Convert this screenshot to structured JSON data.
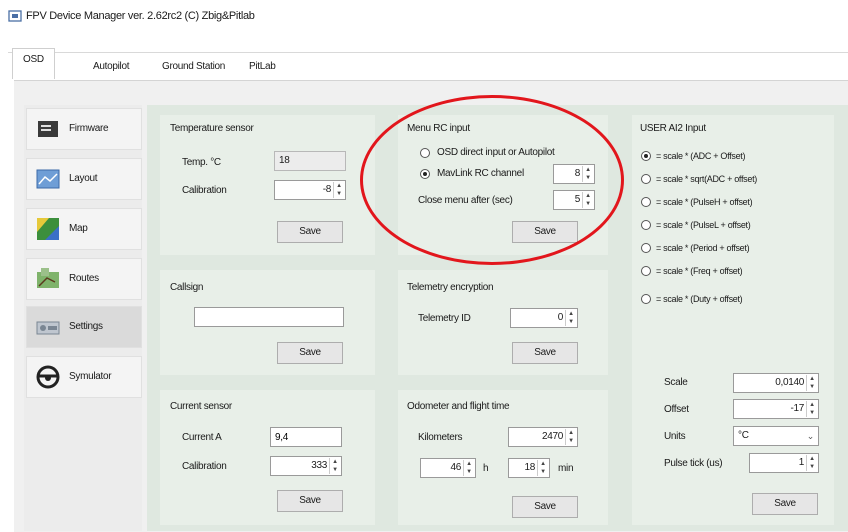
{
  "window": {
    "title": "FPV Device Manager ver. 2.62rc2 (C) Zbig&Pitlab"
  },
  "tabs": [
    {
      "label": "OSD",
      "active": true
    },
    {
      "label": "Autopilot",
      "active": false
    },
    {
      "label": "Ground Station",
      "active": false
    },
    {
      "label": "PitLab",
      "active": false
    }
  ],
  "sidebar": {
    "items": [
      {
        "label": "Firmware",
        "icon": "firmware-chip-icon",
        "active": false
      },
      {
        "label": "Layout",
        "icon": "layout-icon",
        "active": false
      },
      {
        "label": "Map",
        "icon": "map-icon",
        "active": false
      },
      {
        "label": "Routes",
        "icon": "routes-icon",
        "active": false
      },
      {
        "label": "Settings",
        "icon": "settings-icon",
        "active": true
      },
      {
        "label": "Symulator",
        "icon": "steering-wheel-icon",
        "active": false
      }
    ]
  },
  "temperature_sensor": {
    "title": "Temperature sensor",
    "temp_label": "Temp. °C",
    "temp_value": "18",
    "calibration_label": "Calibration",
    "calibration_value": "-8",
    "save_label": "Save"
  },
  "menu_rc_input": {
    "title": "Menu RC input",
    "option1": "OSD direct input or Autopilot",
    "option2": "MavLink RC channel",
    "selected": 2,
    "channel_value": "8",
    "close_after_label": "Close menu after (sec)",
    "close_after_value": "5",
    "save_label": "Save"
  },
  "user_ai2_input": {
    "title": "USER AI2 Input",
    "options": [
      "= scale * (ADC + Offset)",
      "= scale * sqrt(ADC + offset)",
      "= scale * (PulseH + offset)",
      "= scale * (PulseL + offset)",
      "= scale * (Period + offset)",
      "= scale * (Freq + offset)",
      "= scale * (Duty + offset)"
    ],
    "selected": 0,
    "scale_label": "Scale",
    "scale_value": "0,0140",
    "offset_label": "Offset",
    "offset_value": "-17",
    "units_label": "Units",
    "units_value": "°C",
    "pulse_tick_label": "Pulse tick (us)",
    "pulse_tick_value": "1",
    "save_label": "Save"
  },
  "callsign": {
    "title": "Callsign",
    "value": "",
    "save_label": "Save"
  },
  "telemetry_encryption": {
    "title": "Telemetry encryption",
    "id_label": "Telemetry ID",
    "id_value": "0",
    "save_label": "Save"
  },
  "current_sensor": {
    "title": "Current sensor",
    "current_label": "Current A",
    "current_value": "9,4",
    "calibration_label": "Calibration",
    "calibration_value": "333",
    "save_label": "Save"
  },
  "odometer": {
    "title": "Odometer  and flight time",
    "km_label": "Kilometers",
    "km_value": "2470",
    "hours_value": "46",
    "hours_unit": "h",
    "min_value": "18",
    "min_unit": "min",
    "save_label": "Save"
  },
  "colors": {
    "highlight": "#e2161c",
    "panel": "#e8efe8",
    "background": "#dfe8e0"
  }
}
